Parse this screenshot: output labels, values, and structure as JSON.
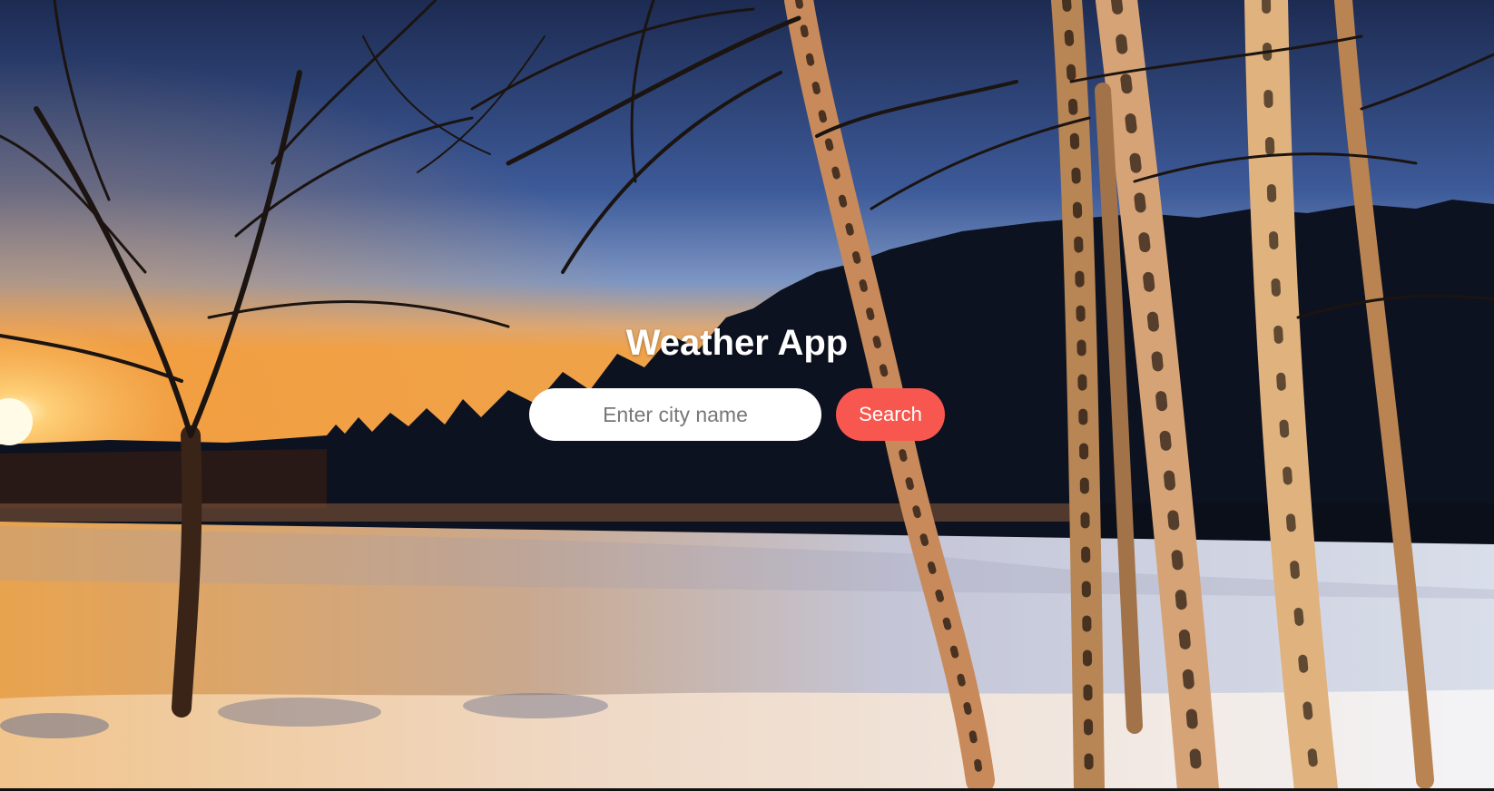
{
  "app": {
    "title": "Weather App"
  },
  "search": {
    "placeholder": "Enter city name",
    "value": "",
    "button_label": "Search"
  },
  "colors": {
    "button": "#f7574f",
    "title": "#ffffff",
    "input_background": "#ffffff"
  }
}
